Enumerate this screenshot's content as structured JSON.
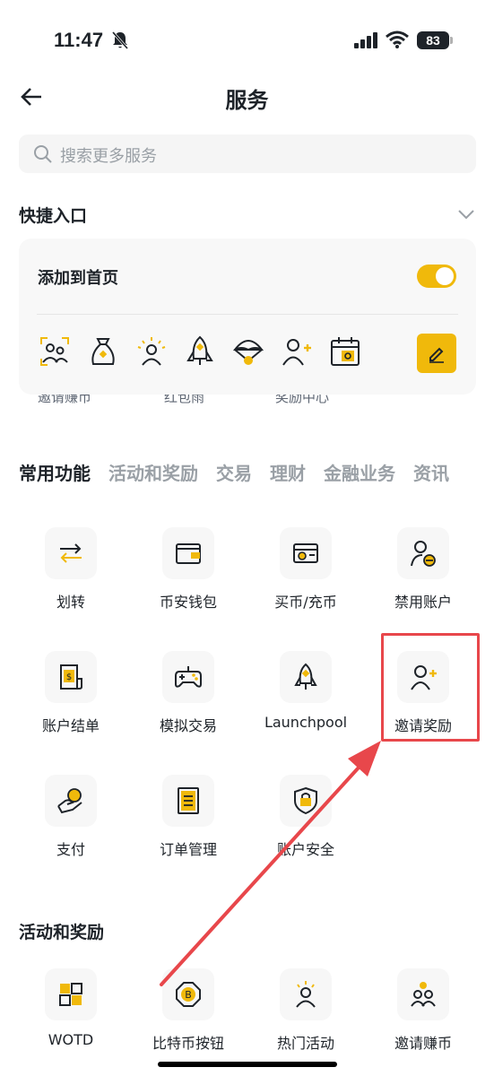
{
  "status_bar": {
    "time": "11:47",
    "battery": "83"
  },
  "nav": {
    "title": "服务"
  },
  "search": {
    "placeholder": "搜索更多服务"
  },
  "quick_entry": {
    "title": "快捷入口",
    "add_to_home": "添加到首页",
    "toggle_on": true,
    "icons": [
      "invite-earn-icon",
      "money-bag-icon",
      "person-sun-icon",
      "rocket-icon",
      "parachute-icon",
      "person-add-icon",
      "calendar-icon"
    ],
    "clipped_labels": [
      "邀请赚币",
      "红包雨",
      "奖励中心"
    ]
  },
  "tabs": [
    "常用功能",
    "活动和奖励",
    "交易",
    "理财",
    "金融业务",
    "资讯"
  ],
  "common_functions": [
    {
      "label": "划转",
      "icon": "transfer-icon"
    },
    {
      "label": "币安钱包",
      "icon": "wallet-icon"
    },
    {
      "label": "买币/充币",
      "icon": "buy-card-icon"
    },
    {
      "label": "禁用账户",
      "icon": "disable-account-icon"
    },
    {
      "label": "账户结单",
      "icon": "statement-icon"
    },
    {
      "label": "模拟交易",
      "icon": "gamepad-icon"
    },
    {
      "label": "Launchpool",
      "icon": "rocket-icon"
    },
    {
      "label": "邀请奖励",
      "icon": "person-add-icon"
    },
    {
      "label": "支付",
      "icon": "payment-icon"
    },
    {
      "label": "订单管理",
      "icon": "order-icon"
    },
    {
      "label": "账户安全",
      "icon": "shield-lock-icon"
    }
  ],
  "activities": {
    "title": "活动和奖励",
    "items": [
      {
        "label": "WOTD",
        "icon": "wotd-icon"
      },
      {
        "label": "比特币按钮",
        "icon": "bitcoin-button-icon"
      },
      {
        "label": "热门活动",
        "icon": "person-sun-icon"
      },
      {
        "label": "邀请赚币",
        "icon": "invite-earn-icon"
      }
    ]
  },
  "colors": {
    "accent": "#f0b90b",
    "annotation": "#e8474b",
    "text": "#1e2329"
  }
}
